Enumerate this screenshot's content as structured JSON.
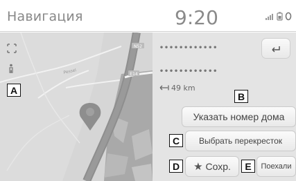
{
  "header": {
    "title": "Навигация",
    "time": "9:20"
  },
  "panel": {
    "masked_line_1": "••••••••••••",
    "masked_line_2": "••••••••••••",
    "distance": "49 km"
  },
  "buttons": {
    "house_number": "Указать номер дома",
    "intersection": "Выбрать перекресток",
    "save": "Сохр.",
    "go": "Поехали"
  },
  "callouts": {
    "a": "A",
    "b": "B",
    "c": "C",
    "d": "D",
    "e": "E"
  },
  "map": {
    "road_badge_1": "N52",
    "road_badge_2": "E14",
    "street_label": "Pessel",
    "pin_color": "#8c8c8c"
  },
  "icons": [
    "expand-arrows-icon",
    "pedestrian-icon",
    "back-arrow-icon",
    "distance-arrow-icon",
    "star-icon",
    "signal-icon",
    "battery-icon"
  ]
}
